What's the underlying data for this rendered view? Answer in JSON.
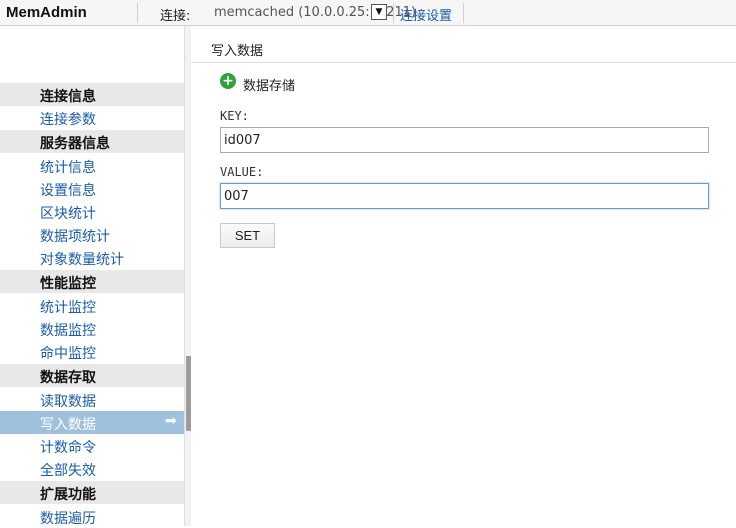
{
  "app": {
    "brand": "MemAdmin"
  },
  "topbar": {
    "connection_label": "连接:",
    "connection_value": "memcached (10.0.0.25:11211)",
    "dropdown_glyph": "▼",
    "connection_settings": "连接设置"
  },
  "sidebar": {
    "sections": [
      {
        "title": "连接信息",
        "items": [
          "连接参数"
        ]
      },
      {
        "title": "服务器信息",
        "items": [
          "统计信息",
          "设置信息",
          "区块统计",
          "数据项统计",
          "对象数量统计"
        ]
      },
      {
        "title": "性能监控",
        "items": [
          "统计监控",
          "数据监控",
          "命中监控"
        ]
      },
      {
        "title": "数据存取",
        "items": [
          "读取数据",
          "写入数据",
          "计数命令",
          "全部失效"
        ]
      },
      {
        "title": "扩展功能",
        "items": [
          "数据遍历"
        ]
      }
    ],
    "active_item": "写入数据",
    "active_arrow": "➡"
  },
  "main": {
    "page_title": "写入数据",
    "action_icon": "plus-circle-icon",
    "action_label": "数据存储",
    "key_label": "KEY:",
    "key_value": "id007",
    "value_label": "VALUE:",
    "value_value": "007",
    "set_button": "SET"
  },
  "colors": {
    "link": "#1a5ca8",
    "active_item_bg": "#9fc1dd",
    "section_bg": "#e8e8e8",
    "add_icon": "#2ea33a"
  }
}
